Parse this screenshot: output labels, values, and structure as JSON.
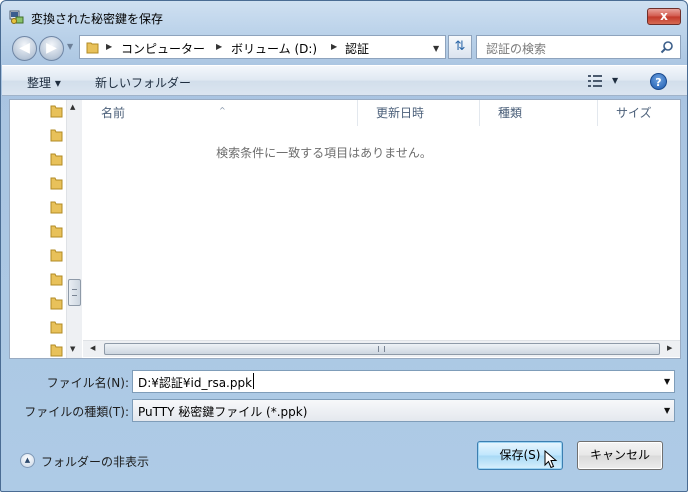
{
  "window": {
    "title": "変換された秘密鍵を保存",
    "close_label": "x"
  },
  "nav": {
    "back_icon": "back-arrow-icon",
    "forward_icon": "forward-arrow-icon",
    "breadcrumb": [
      "コンピューター",
      "ボリューム (D:)",
      "認証"
    ],
    "search_placeholder": "認証の検索"
  },
  "toolbar": {
    "organize_label": "整理 ▾",
    "new_folder_label": "新しいフォルダー",
    "help_label": "?"
  },
  "file_list": {
    "columns": [
      "名前",
      "更新日時",
      "種類",
      "サイズ"
    ],
    "empty_message": "検索条件に一致する項目はありません。"
  },
  "fields": {
    "filename_label": "ファイル名(N):",
    "filename_value": "D:¥認証¥id_rsa.ppk",
    "filetype_label": "ファイルの種類(T):",
    "filetype_value": "PuTTY 秘密鍵ファイル (*.ppk)"
  },
  "footer": {
    "toggle_folders_label": "フォルダーの非表示",
    "save_label": "保存(S)",
    "cancel_label": "キャンセル"
  },
  "colors": {
    "window_frame": "#a9c4e1",
    "save_button": "#bee6fd",
    "folder": "#e8c15a"
  }
}
